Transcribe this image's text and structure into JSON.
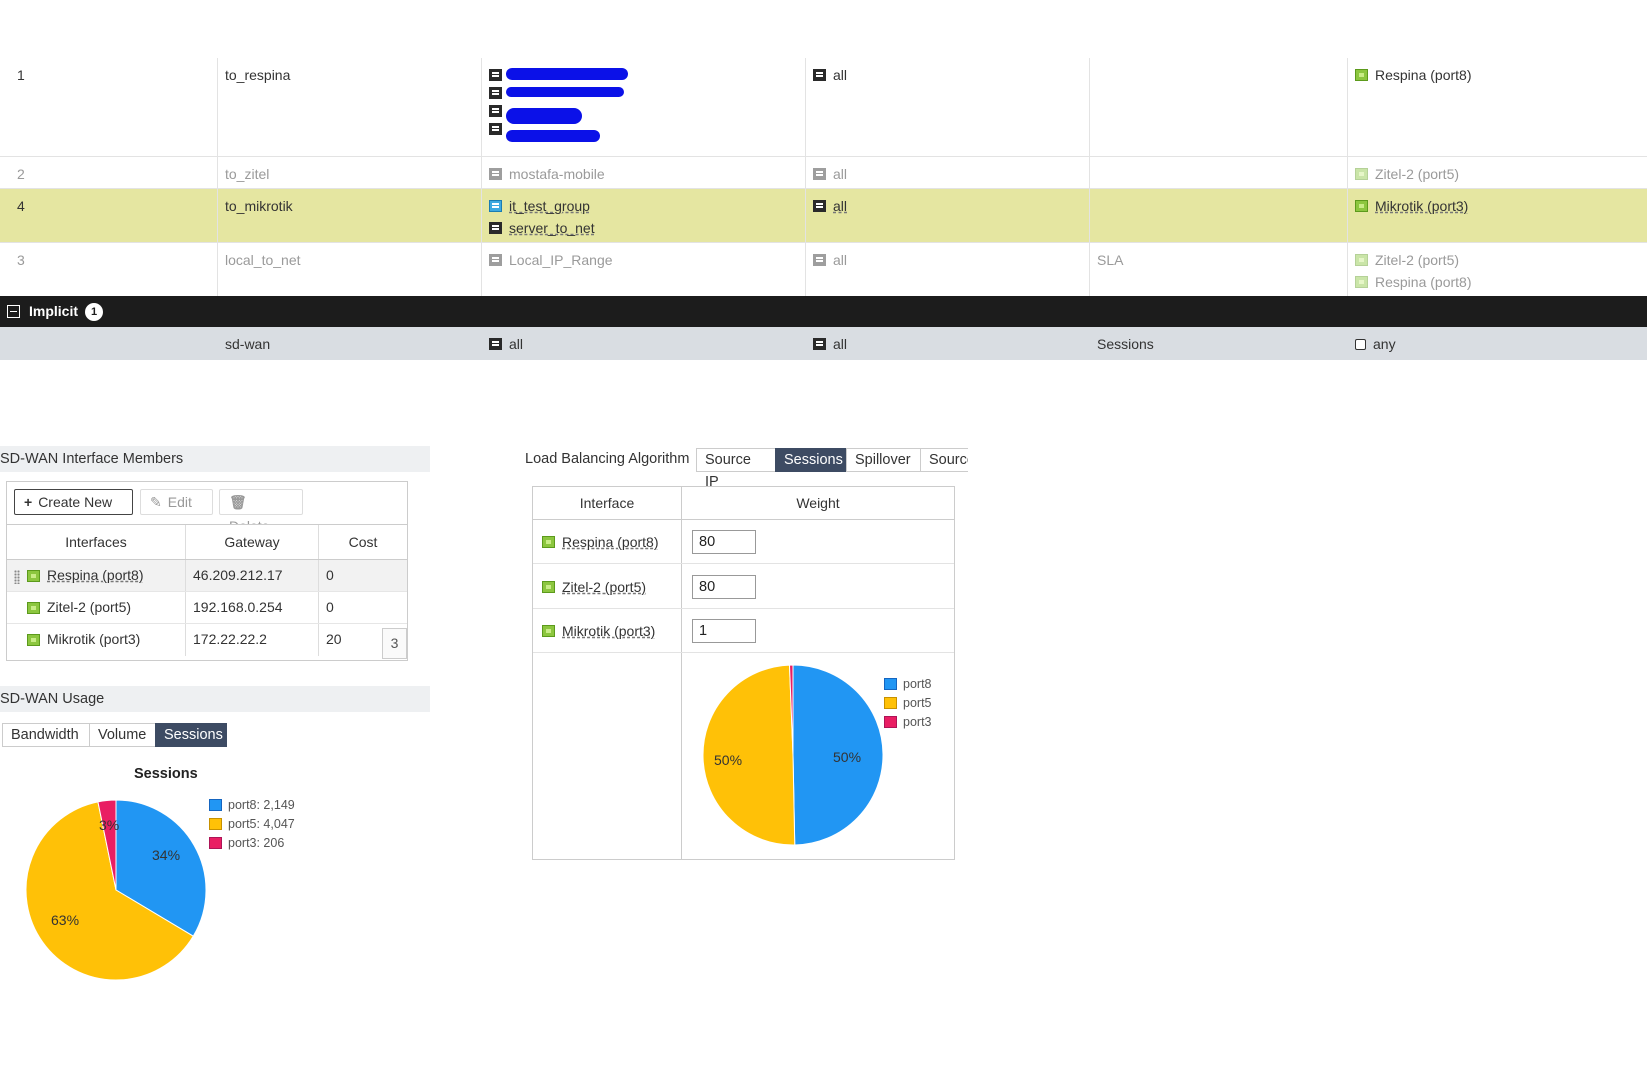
{
  "policies": [
    {
      "seq": "1",
      "name": "to_respina",
      "sources": [
        {
          "text": "",
          "icon": "address-icon"
        },
        {
          "text": "",
          "icon": "address-icon"
        },
        {
          "text": "",
          "icon": "address-icon"
        },
        {
          "text": "",
          "icon": "address-icon"
        }
      ],
      "destination": "all",
      "criteria": "",
      "members": [
        "Respina (port8)"
      ]
    },
    {
      "seq": "2",
      "name": "to_zitel",
      "sources": [
        {
          "text": "mostafa-mobile",
          "icon": "address-icon"
        }
      ],
      "destination": "all",
      "criteria": "",
      "members": [
        "Zitel-2 (port5)"
      ]
    },
    {
      "seq": "4",
      "name": "to_mikrotik",
      "sources": [
        {
          "text": "it_test_group",
          "icon": "address-group-icon"
        },
        {
          "text": "server_to_net",
          "icon": "address-group-icon"
        }
      ],
      "destination": "all",
      "criteria": "",
      "members": [
        "Mikrotik (port3)"
      ]
    },
    {
      "seq": "3",
      "name": "local_to_net",
      "sources": [
        {
          "text": "Local_IP_Range",
          "icon": "address-icon"
        }
      ],
      "destination": "all",
      "criteria": "SLA",
      "members": [
        "Zitel-2 (port5)",
        "Respina (port8)"
      ]
    }
  ],
  "implicit": {
    "label": "Implicit",
    "count": "1",
    "row": {
      "name": "sd-wan",
      "source": "all",
      "destination": "all",
      "criteria": "Sessions",
      "members": "any"
    }
  },
  "members_section": {
    "title": "SD-WAN Interface Members",
    "toolbar": {
      "create": "Create New",
      "edit": "Edit",
      "delete": "Delete"
    },
    "columns": [
      "Interfaces",
      "Gateway",
      "Cost"
    ],
    "rows": [
      {
        "interface": "Respina (port8)",
        "gateway": "46.209.212.17",
        "cost": "0"
      },
      {
        "interface": "Zitel-2 (port5)",
        "gateway": "192.168.0.254",
        "cost": "0"
      },
      {
        "interface": "Mikrotik (port3)",
        "gateway": "172.22.22.2",
        "cost": "20"
      }
    ],
    "count_badge": "3"
  },
  "usage_section": {
    "title": "SD-WAN Usage",
    "tabs": [
      "Bandwidth",
      "Volume",
      "Sessions"
    ],
    "active_tab": "Sessions"
  },
  "load_balancing": {
    "label": "Load Balancing Algorithm",
    "options": [
      "Source IP",
      "Sessions",
      "Spillover",
      "Source"
    ],
    "active": "Sessions",
    "columns": [
      "Interface",
      "Weight"
    ],
    "rows": [
      {
        "interface": "Respina (port8)",
        "weight": "80"
      },
      {
        "interface": "Zitel-2 (port5)",
        "weight": "80"
      },
      {
        "interface": "Mikrotik (port3)",
        "weight": "1"
      }
    ]
  },
  "colors": {
    "port8": "#2196f3",
    "port5": "#ffc107",
    "port3": "#e91e63",
    "selected_row": "#e5e6a1",
    "active_tab": "#3d4b63"
  },
  "chart_data": [
    {
      "type": "pie",
      "title": "Sessions",
      "categories": [
        "port8",
        "port5",
        "port3"
      ],
      "values": [
        2149,
        4047,
        206
      ],
      "legend": [
        "port8: 2,149",
        "port5: 4,047",
        "port3: 206"
      ],
      "labels": [
        "34%",
        "63%",
        "3%"
      ],
      "legend_position": "right"
    },
    {
      "type": "pie",
      "title": "",
      "categories": [
        "port8",
        "port5",
        "port3"
      ],
      "values": [
        80,
        80,
        1
      ],
      "legend": [
        "port8",
        "port5",
        "port3"
      ],
      "labels": [
        "50%",
        "50%"
      ],
      "legend_position": "right"
    }
  ]
}
